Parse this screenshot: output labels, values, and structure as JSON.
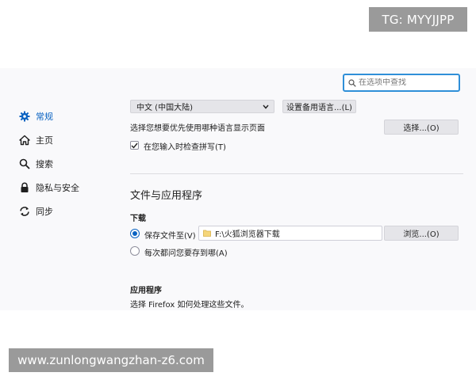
{
  "watermarks": {
    "top": "TG: MYYJJPP",
    "bottom": "www.zunlongwangzhan-z6.com"
  },
  "search": {
    "placeholder": "在选项中查找"
  },
  "nav": {
    "items": [
      {
        "label": "常规",
        "icon": "gear-icon",
        "active": true
      },
      {
        "label": "主页",
        "icon": "home-icon"
      },
      {
        "label": "搜索",
        "icon": "search-icon"
      },
      {
        "label": "隐私与安全",
        "icon": "lock-icon"
      },
      {
        "label": "同步",
        "icon": "sync-icon"
      }
    ]
  },
  "language": {
    "selected": "中文 (中国大陆)",
    "alternatives_button": "设置备用语言...(L)",
    "prefer_text": "选择您想要优先使用哪种语言显示页面",
    "choose_button": "选择...(O)",
    "spellcheck_label": "在您输入时检查拼写(T)",
    "spellcheck_checked": true
  },
  "files_apps": {
    "title": "文件与应用程序",
    "downloads_title": "下载",
    "save_to_label": "保存文件至(V)",
    "save_path": "F:\\火狐浏览器下载",
    "browse_button": "浏览...(O)",
    "ask_label": "每次都问您要存到哪(A)",
    "save_selected": true,
    "apps_title": "应用程序",
    "apps_desc": "选择 Firefox 如何处理这些文件。"
  },
  "colors": {
    "accent": "#0a63c2",
    "focus": "#2f8fd8",
    "background": "#f9f9fb",
    "watermark": "#9a9a9a"
  }
}
